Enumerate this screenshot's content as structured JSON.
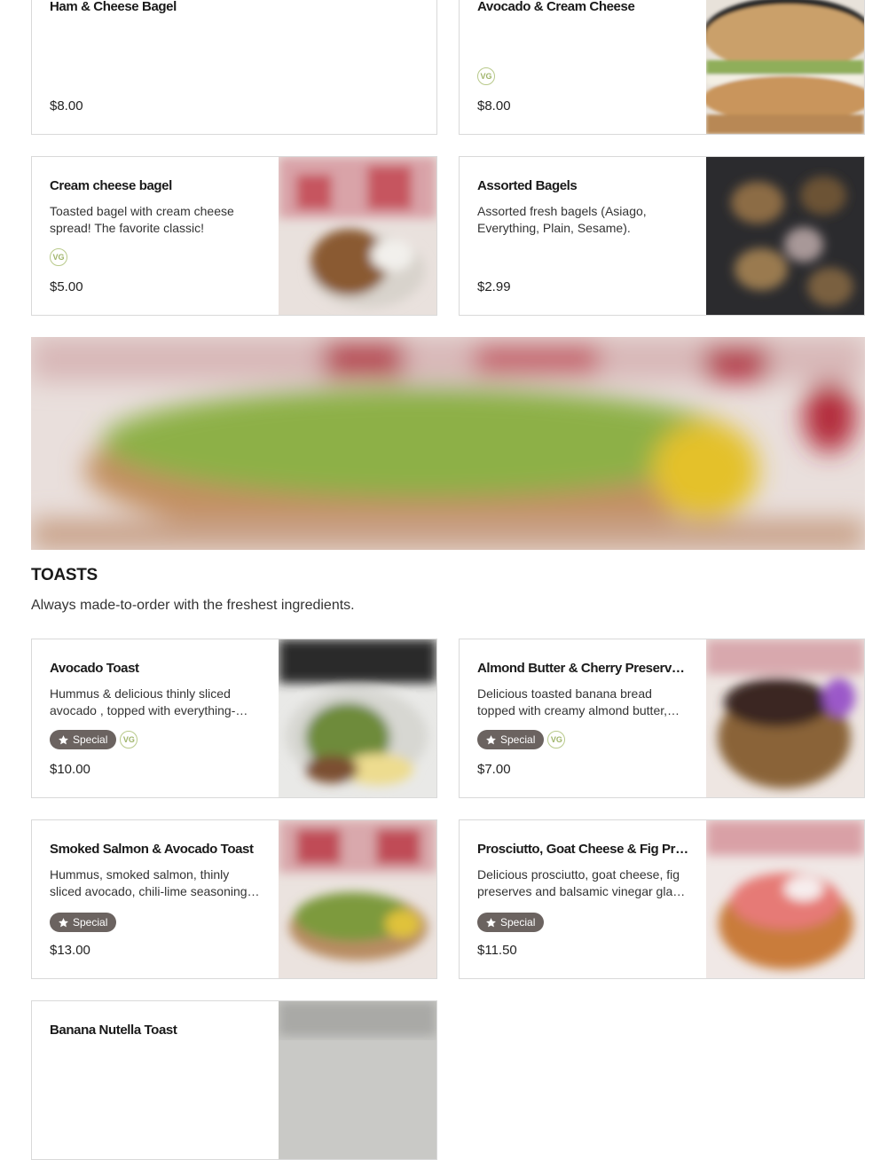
{
  "bagels": {
    "items": [
      {
        "name": "Ham & Cheese Bagel",
        "description": "",
        "price": "$8.00",
        "vegetarian": false,
        "special": false,
        "has_image": false
      },
      {
        "name": "Avocado & Cream Cheese",
        "description": "",
        "price": "$8.00",
        "vegetarian": true,
        "special": false,
        "has_image": true
      },
      {
        "name": "Cream cheese bagel",
        "description": "Toasted bagel with cream cheese spread! The favorite classic!",
        "price": "$5.00",
        "vegetarian": true,
        "special": false,
        "has_image": true
      },
      {
        "name": "Assorted Bagels",
        "description": "Assorted fresh bagels (Asiago, Everything, Plain, Sesame).",
        "price": "$2.99",
        "vegetarian": false,
        "special": false,
        "has_image": true
      }
    ]
  },
  "toasts": {
    "title": "TOASTS",
    "description": "Always made-to-order with the freshest ingredients.",
    "items": [
      {
        "name": "Avocado Toast",
        "description": "Hummus & delicious thinly sliced avocado , topped with everything-…",
        "price": "$10.00",
        "vegetarian": true,
        "special": true
      },
      {
        "name": "Almond Butter & Cherry Preserve o…",
        "description": "Delicious toasted banana bread topped with creamy almond butter,…",
        "price": "$7.00",
        "vegetarian": true,
        "special": true
      },
      {
        "name": "Smoked Salmon & Avocado Toast",
        "description": "Hummus, smoked salmon, thinly sliced avocado, chili-lime seasoning…",
        "price": "$13.00",
        "vegetarian": false,
        "special": true
      },
      {
        "name": "Prosciutto, Goat Cheese & Fig Pres…",
        "description": "Delicious prosciutto, goat cheese, fig preserves and balsamic vinegar gla…",
        "price": "$11.50",
        "vegetarian": false,
        "special": true
      },
      {
        "name": "Banana Nutella Toast",
        "description": "",
        "price": "",
        "vegetarian": false,
        "special": false
      }
    ]
  },
  "labels": {
    "special": "Special",
    "vg": "VG"
  },
  "colors": {
    "badge_bg": "#6b6360",
    "vg_outline": "#b8c98a",
    "border": "#d9d9d9"
  }
}
